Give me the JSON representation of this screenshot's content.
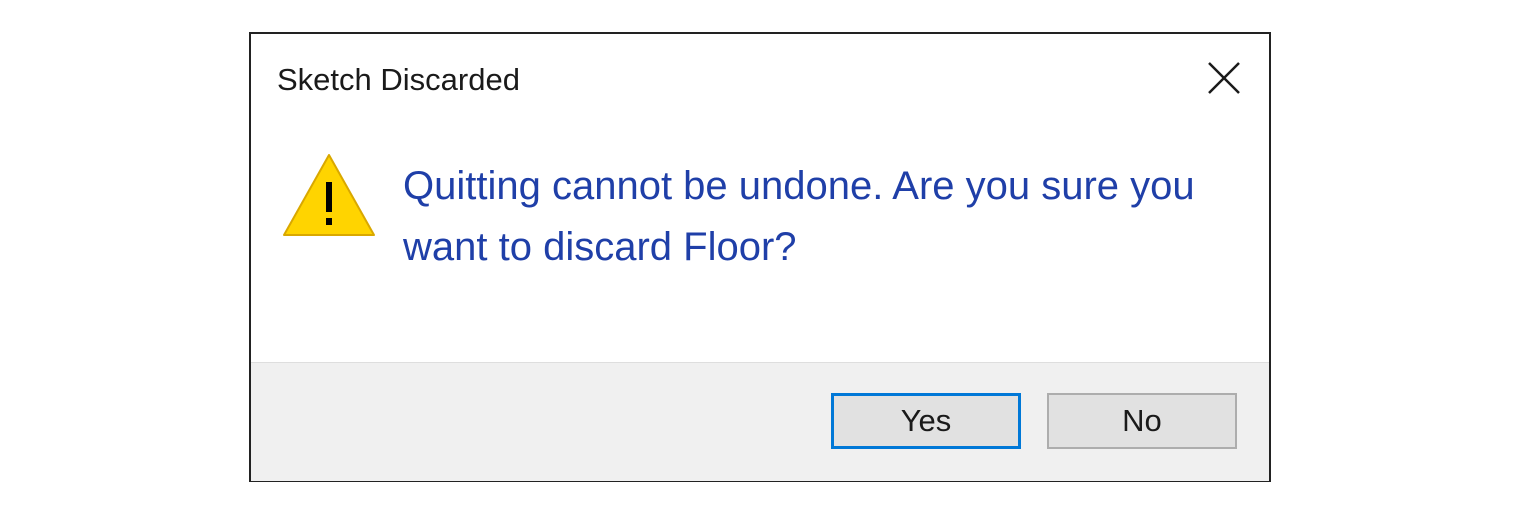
{
  "dialog": {
    "title": "Sketch Discarded",
    "message": "Quitting cannot be undone. Are you sure you want to discard Floor?",
    "icon": "warning-icon",
    "close_icon": "close-icon"
  },
  "buttons": {
    "yes_label": "Yes",
    "no_label": "No"
  },
  "colors": {
    "message_text": "#1f3fa8",
    "default_button_border": "#0078d7",
    "warning_fill": "#ffd400",
    "footer_background": "#f0f0f0"
  }
}
